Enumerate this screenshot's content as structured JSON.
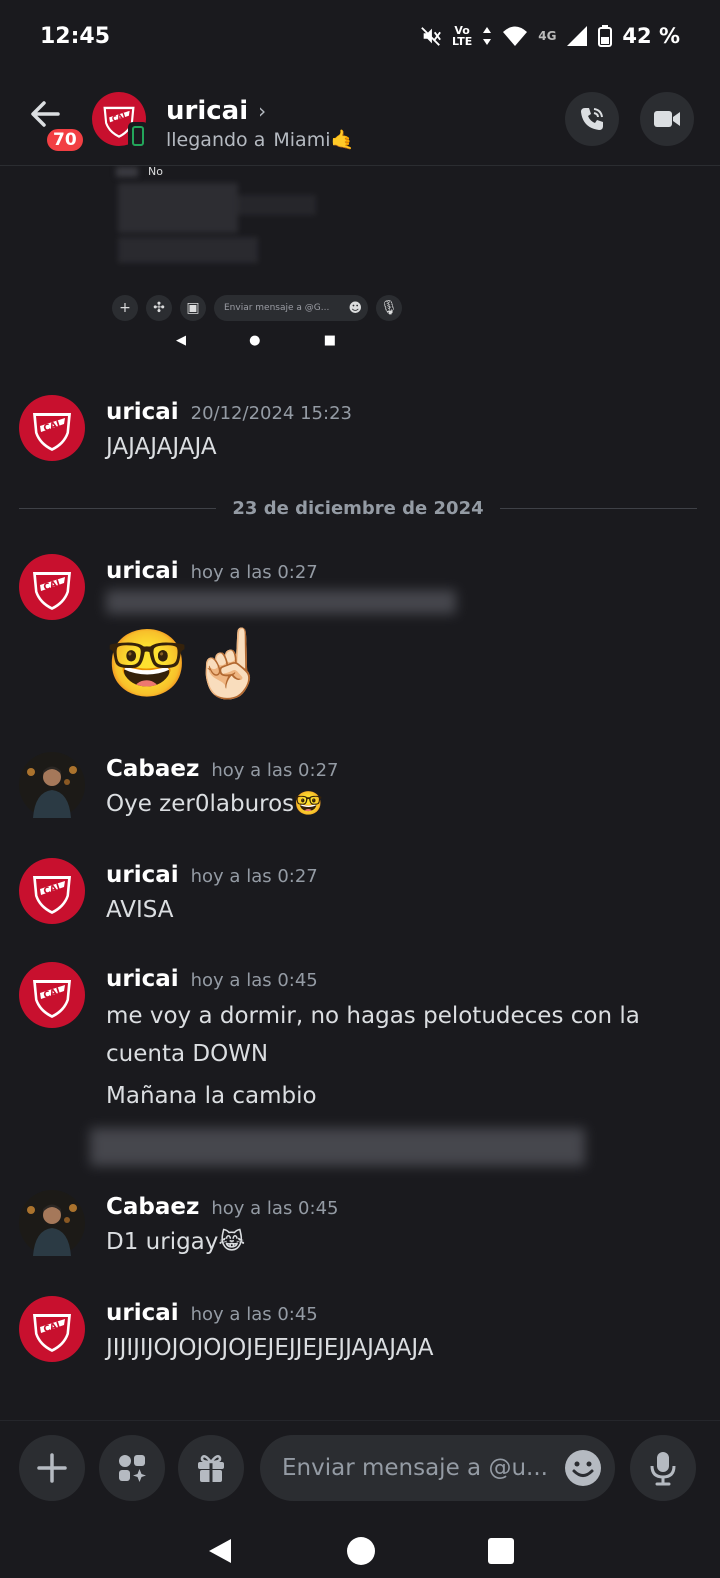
{
  "status_bar": {
    "time": "12:45",
    "volte_top": "Vo",
    "volte_bottom": "LTE",
    "network": "4G",
    "battery": "42 %",
    "icons": [
      "mute-icon",
      "volte-icon",
      "wifi-icon",
      "signal-icon",
      "battery-icon"
    ]
  },
  "header": {
    "unread_count": "70",
    "name": "uricai",
    "chevron": "›",
    "status_text": "llegando a",
    "status_place": "Miami🤙",
    "icons": [
      "back-arrow-icon",
      "phone-call-icon",
      "video-camera-icon"
    ]
  },
  "embed": {
    "first_line": "No",
    "input_placeholder": "Enviar mensaje a @G..."
  },
  "messages": [
    {
      "author": "uricai",
      "time": "20/12/2024 15:23",
      "lines": [
        "JAJAJAJAJA"
      ]
    },
    {
      "author": "uricai",
      "time": "hoy a las 0:27",
      "lines": [],
      "emoji": "🤓☝🏻"
    },
    {
      "author": "Cabaez",
      "time": "hoy a las 0:27",
      "lines": [
        "Oye zer0laburos🤓"
      ]
    },
    {
      "author": "uricai",
      "time": "hoy a las 0:27",
      "lines": [
        "AVISA"
      ]
    },
    {
      "author": "uricai",
      "time": "hoy a las 0:45",
      "lines": [
        "me voy a dormir, no hagas pelotudeces con la",
        "cuenta DOWN",
        "Mañana la cambio"
      ]
    },
    {
      "author": "Cabaez",
      "time": "hoy a las 0:45",
      "lines": [
        "D1 urigay😹"
      ]
    },
    {
      "author": "uricai",
      "time": "hoy a las 0:45",
      "lines": [
        "JIJIJIJOJOJOJOJEJEJJEJEJJAJAJAJA"
      ]
    }
  ],
  "date_divider": "23 de diciembre de 2024",
  "composer": {
    "placeholder": "Enviar mensaje a @u...",
    "icons": [
      "plus-icon",
      "apps-icon",
      "gift-icon",
      "emoji-icon",
      "microphone-icon"
    ]
  },
  "nav": {
    "icons": [
      "nav-back-icon",
      "nav-home-icon",
      "nav-recents-icon"
    ]
  },
  "colors": {
    "background": "#1a1a1e",
    "accent_red": "#f23f43",
    "online_green": "#23a55a",
    "avatar_red": "#c8102e"
  }
}
